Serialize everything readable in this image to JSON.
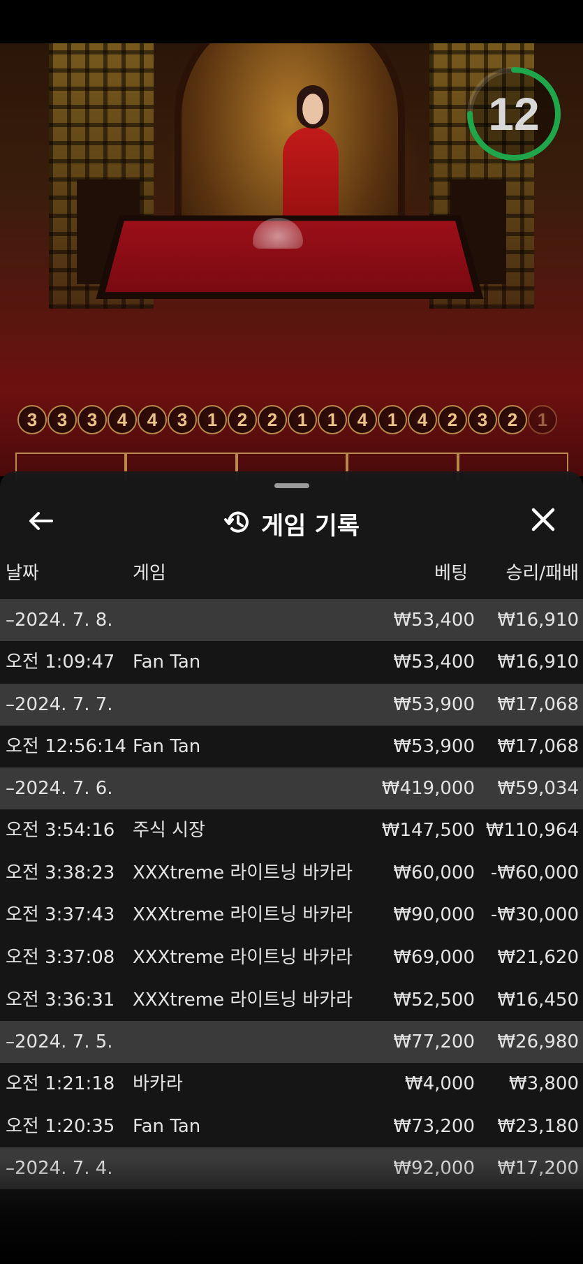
{
  "timer": {
    "value": "12",
    "progress": 0.75,
    "accent_color": "#1fa64a"
  },
  "roadmap": [
    "3",
    "3",
    "3",
    "4",
    "4",
    "3",
    "1",
    "2",
    "2",
    "1",
    "1",
    "4",
    "1",
    "4",
    "2",
    "3",
    "2",
    "1"
  ],
  "history": {
    "title": "게임 기록",
    "title_icon": "history-icon",
    "back_icon": "arrow-left-icon",
    "close_icon": "close-icon",
    "columns": {
      "date": "날짜",
      "game": "게임",
      "bet": "베팅",
      "result": "승리/패배"
    },
    "rows": [
      {
        "type": "date",
        "time": "–2024. 7. 8.",
        "game": "",
        "bet": "₩53,400",
        "win": "₩16,910"
      },
      {
        "type": "item",
        "time": "오전 1:09:47",
        "game": "Fan Tan",
        "bet": "₩53,400",
        "win": "₩16,910"
      },
      {
        "type": "date",
        "time": "–2024. 7. 7.",
        "game": "",
        "bet": "₩53,900",
        "win": "₩17,068"
      },
      {
        "type": "item",
        "time": "오전 12:56:14",
        "game": "Fan Tan",
        "bet": "₩53,900",
        "win": "₩17,068"
      },
      {
        "type": "date",
        "time": "–2024. 7. 6.",
        "game": "",
        "bet": "₩419,000",
        "win": "₩59,034"
      },
      {
        "type": "item",
        "time": "오전 3:54:16",
        "game": "주식 시장",
        "bet": "₩147,500",
        "win": "₩110,964"
      },
      {
        "type": "item",
        "time": "오전 3:38:23",
        "game": "XXXtreme 라이트닝 바카라",
        "bet": "₩60,000",
        "win": "-₩60,000"
      },
      {
        "type": "item",
        "time": "오전 3:37:43",
        "game": "XXXtreme 라이트닝 바카라",
        "bet": "₩90,000",
        "win": "-₩30,000"
      },
      {
        "type": "item",
        "time": "오전 3:37:08",
        "game": "XXXtreme 라이트닝 바카라",
        "bet": "₩69,000",
        "win": "₩21,620"
      },
      {
        "type": "item",
        "time": "오전 3:36:31",
        "game": "XXXtreme 라이트닝 바카라",
        "bet": "₩52,500",
        "win": "₩16,450"
      },
      {
        "type": "date",
        "time": "–2024. 7. 5.",
        "game": "",
        "bet": "₩77,200",
        "win": "₩26,980"
      },
      {
        "type": "item",
        "time": "오전 1:21:18",
        "game": "바카라",
        "bet": "₩4,000",
        "win": "₩3,800"
      },
      {
        "type": "item",
        "time": "오전 1:20:35",
        "game": "Fan Tan",
        "bet": "₩73,200",
        "win": "₩23,180"
      },
      {
        "type": "date",
        "time": "–2024. 7. 4.",
        "game": "",
        "bet": "₩92,000",
        "win": "₩17,200"
      }
    ]
  }
}
